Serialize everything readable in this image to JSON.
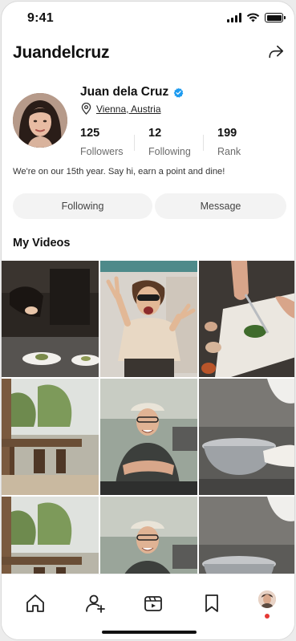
{
  "status_bar": {
    "time": "9:41",
    "battery_level": 1.0
  },
  "header": {
    "username": "Juandelcruz",
    "share_icon": "share-arrow-icon"
  },
  "profile": {
    "name": "Juan dela Cruz",
    "verified": true,
    "location": "Vienna, Austria",
    "stats": [
      {
        "value": "125",
        "label": "Followers"
      },
      {
        "value": "12",
        "label": "Following"
      },
      {
        "value": "199",
        "label": "Rank"
      }
    ],
    "bio": "We're on our 15th year. Say hi, earn a point and dine!"
  },
  "actions": {
    "following_label": "Following",
    "message_label": "Message"
  },
  "videos": {
    "title": "My Videos",
    "thumbnails": [
      "chef-plating-dish",
      "woman-peace-sign",
      "chopping-herbs",
      "restaurant-dining-room",
      "smiling-chef-arms-crossed",
      "chef-mixing-bowl",
      "restaurant-dining-room",
      "smiling-chef-arms-crossed",
      "chef-mixing-bowl"
    ]
  },
  "bottom_nav": {
    "items": [
      "home-icon",
      "add-user-icon",
      "video-clapper-icon",
      "bookmark-icon",
      "profile-avatar"
    ],
    "active": "profile-avatar",
    "active_dot_color": "#e53935"
  },
  "colors": {
    "verified_blue": "#1d9bf0",
    "button_bg": "#f3f3f3"
  }
}
